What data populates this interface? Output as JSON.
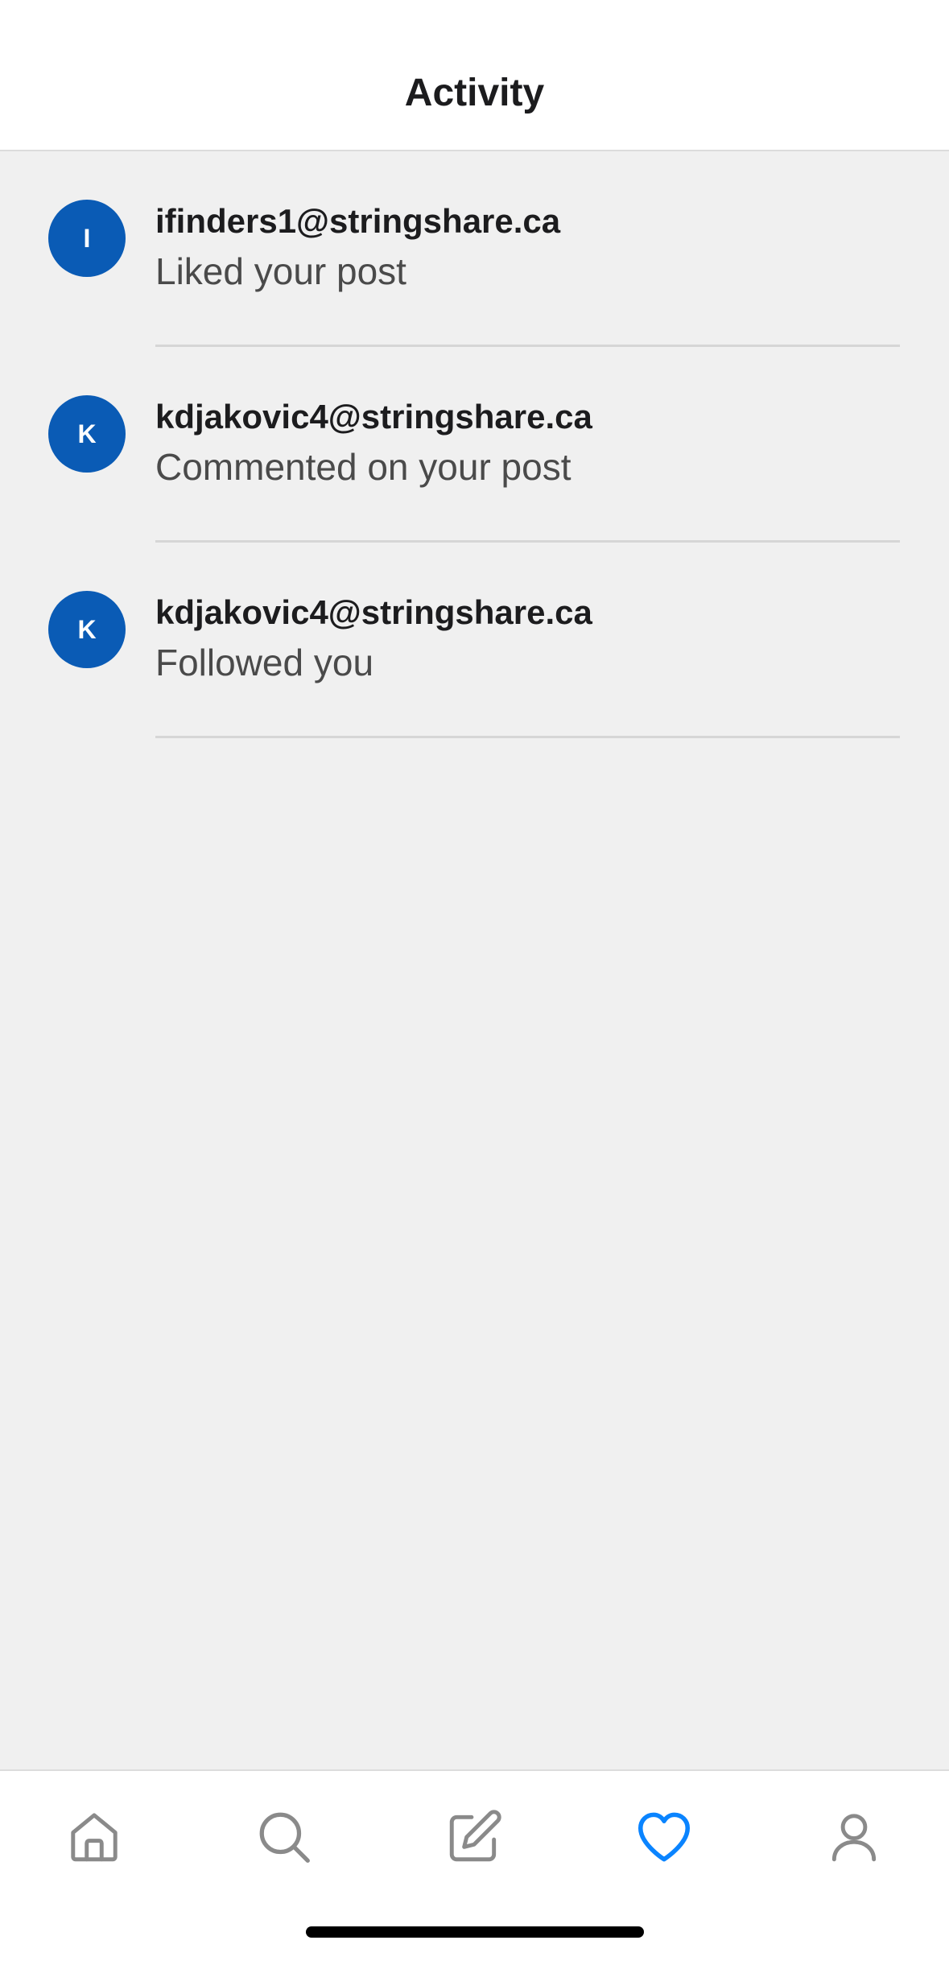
{
  "header": {
    "title": "Activity"
  },
  "activity": [
    {
      "initial": "I",
      "email": "ifinders1@stringshare.ca",
      "action": "Liked your post"
    },
    {
      "initial": "K",
      "email": "kdjakovic4@stringshare.ca",
      "action": "Commented on your post"
    },
    {
      "initial": "K",
      "email": "kdjakovic4@stringshare.ca",
      "action": "Followed you"
    }
  ],
  "tabbar": {
    "tabs": [
      {
        "icon": "home-icon",
        "active": false
      },
      {
        "icon": "search-icon",
        "active": false
      },
      {
        "icon": "compose-icon",
        "active": false
      },
      {
        "icon": "heart-icon",
        "active": true
      },
      {
        "icon": "profile-icon",
        "active": false
      }
    ],
    "active_color": "#0a84ff",
    "inactive_color": "#8a8a8a"
  },
  "colors": {
    "avatar": "#0a5bb5",
    "background": "#f0f0f0"
  }
}
